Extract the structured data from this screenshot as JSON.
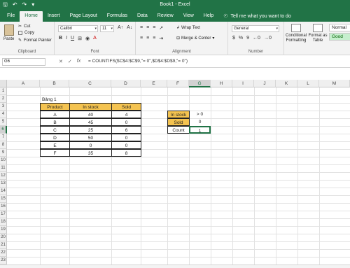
{
  "window": {
    "title": "Book1 - Excel"
  },
  "tabs": [
    "File",
    "Home",
    "Insert",
    "Page Layout",
    "Formulas",
    "Data",
    "Review",
    "View",
    "Help"
  ],
  "active_tab": "Home",
  "tell_me": "Tell me what you want to do",
  "ribbon": {
    "clipboard": {
      "paste": "Paste",
      "cut": "Cut",
      "copy": "Copy",
      "format_painter": "Format Painter",
      "label": "Clipboard"
    },
    "font": {
      "name": "Calibri",
      "size": "11",
      "label": "Font"
    },
    "alignment": {
      "wrap_text": "Wrap Text",
      "merge_center": "Merge & Center",
      "label": "Alignment"
    },
    "number": {
      "format": "General",
      "label": "Number"
    },
    "styles": {
      "conditional_formatting": "Conditional Formatting",
      "format_as_table": "Format as Table",
      "normal": "Normal",
      "good": "Good"
    }
  },
  "formula_bar": {
    "name_box": "G6",
    "formula": "= COUNTIFS($C$4:$C$9,\"= 0\",$D$4:$D$9,\"= 0\")"
  },
  "columns": [
    "A",
    "B",
    "C",
    "D",
    "E",
    "F",
    "G",
    "H",
    "I",
    "J",
    "K",
    "L",
    "M"
  ],
  "rows": [
    "1",
    "2",
    "3",
    "4",
    "5",
    "6",
    "7",
    "8",
    "9",
    "10",
    "11",
    "12",
    "13",
    "14",
    "15",
    "16",
    "17",
    "18",
    "19",
    "20",
    "21",
    "22",
    "23"
  ],
  "sheet": {
    "caption": "Bảng 1",
    "table": {
      "headers": [
        "Product",
        "In stock",
        "Sold"
      ],
      "rows": [
        [
          "A",
          "40",
          "4"
        ],
        [
          "B",
          "45",
          "0"
        ],
        [
          "C",
          "25",
          "6"
        ],
        [
          "D",
          "50",
          "0"
        ],
        [
          "E",
          "0",
          "0"
        ],
        [
          "F",
          "35",
          "8"
        ]
      ]
    },
    "criteria": {
      "in_stock_label": "In stock",
      "in_stock_value": "> 0",
      "sold_label": "Sold",
      "sold_value": "0",
      "count_label": "Count",
      "count_value": "1"
    }
  },
  "colors": {
    "excel_green": "#217346",
    "header_fill": "#f4c350",
    "good_fill": "#c6efce"
  }
}
